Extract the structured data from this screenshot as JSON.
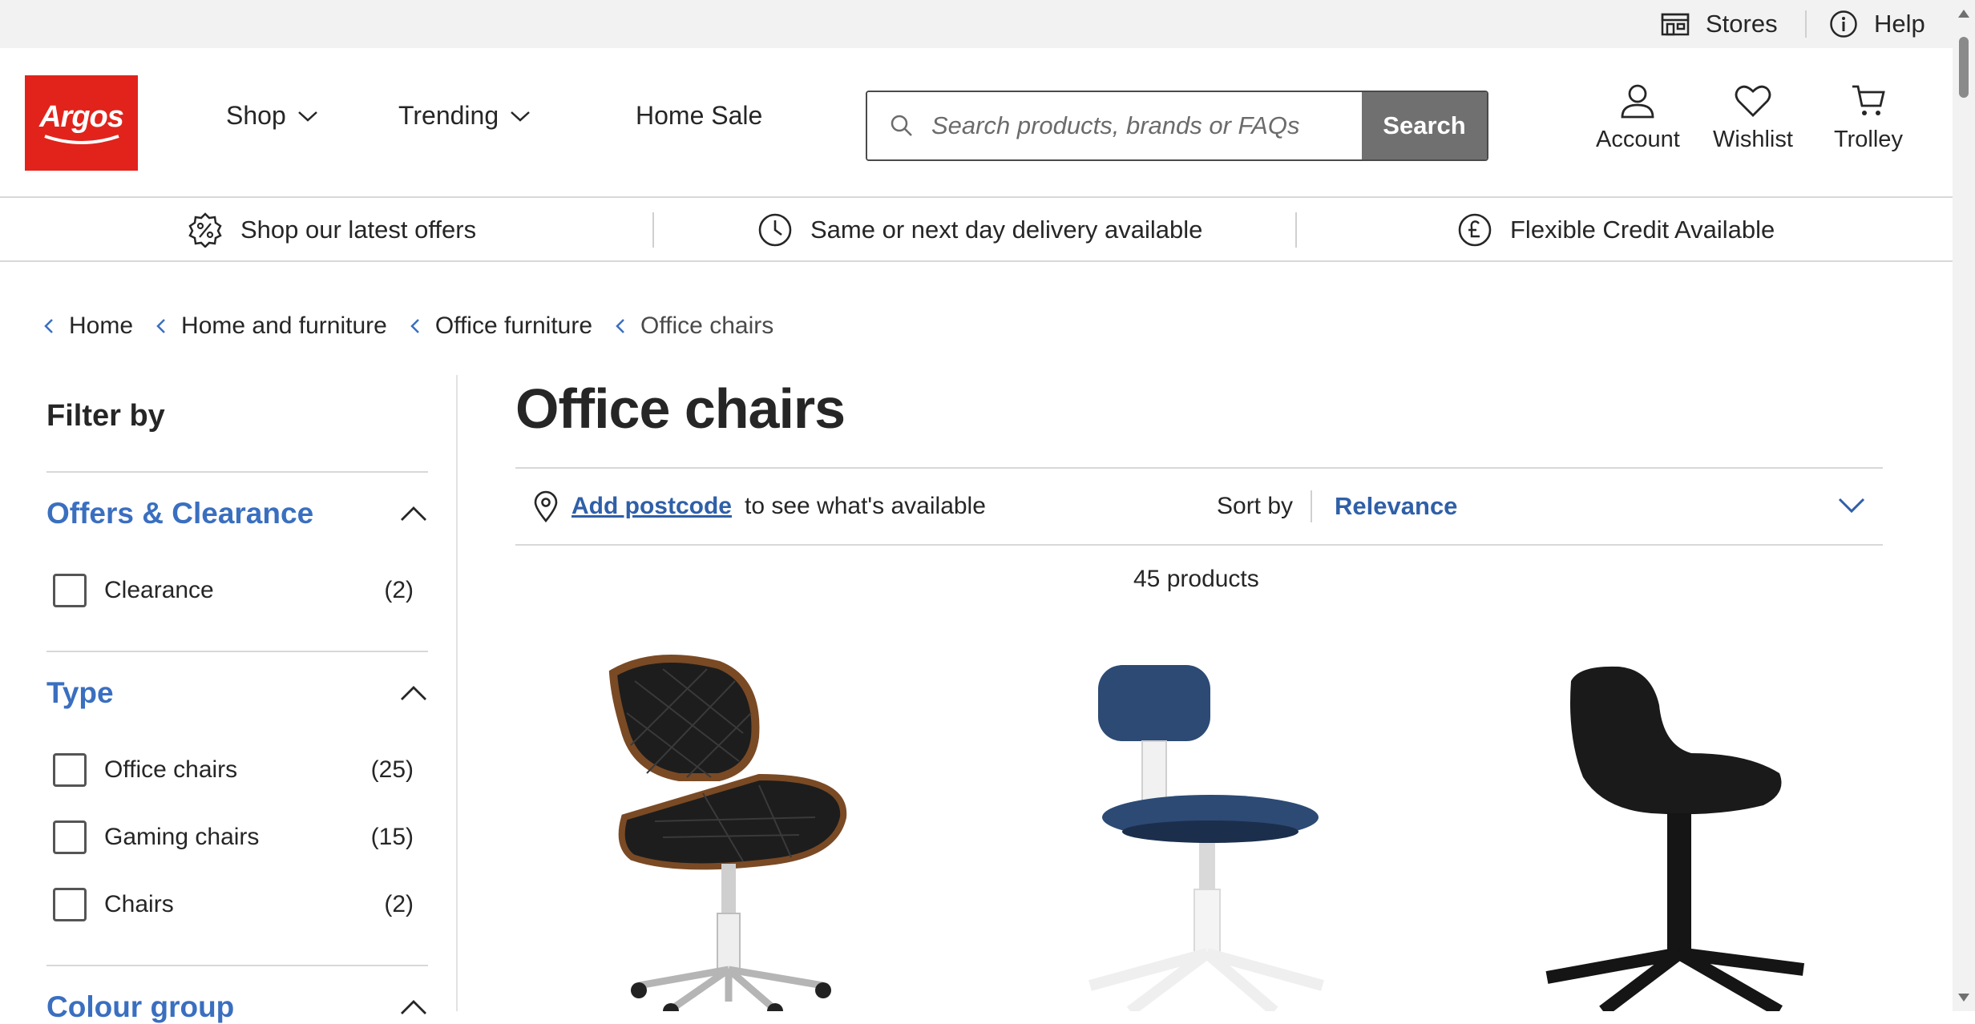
{
  "utility": {
    "stores_label": "Stores",
    "help_label": "Help"
  },
  "header": {
    "logo_text": "Argos",
    "nav": {
      "shop": "Shop",
      "trending": "Trending",
      "home_sale": "Home Sale"
    },
    "search": {
      "placeholder": "Search products, brands or FAQs",
      "button_label": "Search"
    },
    "actions": {
      "account": "Account",
      "wishlist": "Wishlist",
      "trolley": "Trolley"
    }
  },
  "usp": {
    "offers": "Shop our latest offers",
    "delivery": "Same or next day delivery available",
    "credit": "Flexible Credit Available"
  },
  "breadcrumb": {
    "items": [
      "Home",
      "Home and furniture",
      "Office furniture",
      "Office chairs"
    ]
  },
  "filters": {
    "title": "Filter by",
    "sections": [
      {
        "heading": "Offers & Clearance",
        "options": [
          {
            "label": "Clearance",
            "count": "(2)"
          }
        ]
      },
      {
        "heading": "Type",
        "options": [
          {
            "label": "Office chairs",
            "count": "(25)"
          },
          {
            "label": "Gaming chairs",
            "count": "(15)"
          },
          {
            "label": "Chairs",
            "count": "(2)"
          }
        ]
      },
      {
        "heading": "Colour group"
      }
    ]
  },
  "main": {
    "title": "Office chairs",
    "postcode_link": "Add postcode",
    "postcode_text": "to see what's available",
    "sort_label": "Sort by",
    "sort_value": "Relevance",
    "product_count": "45 products"
  },
  "colors": {
    "brand_red": "#e1231c",
    "link_blue": "#2f5fa8",
    "heading_blue": "#3a6fc0",
    "search_button": "#707070"
  }
}
